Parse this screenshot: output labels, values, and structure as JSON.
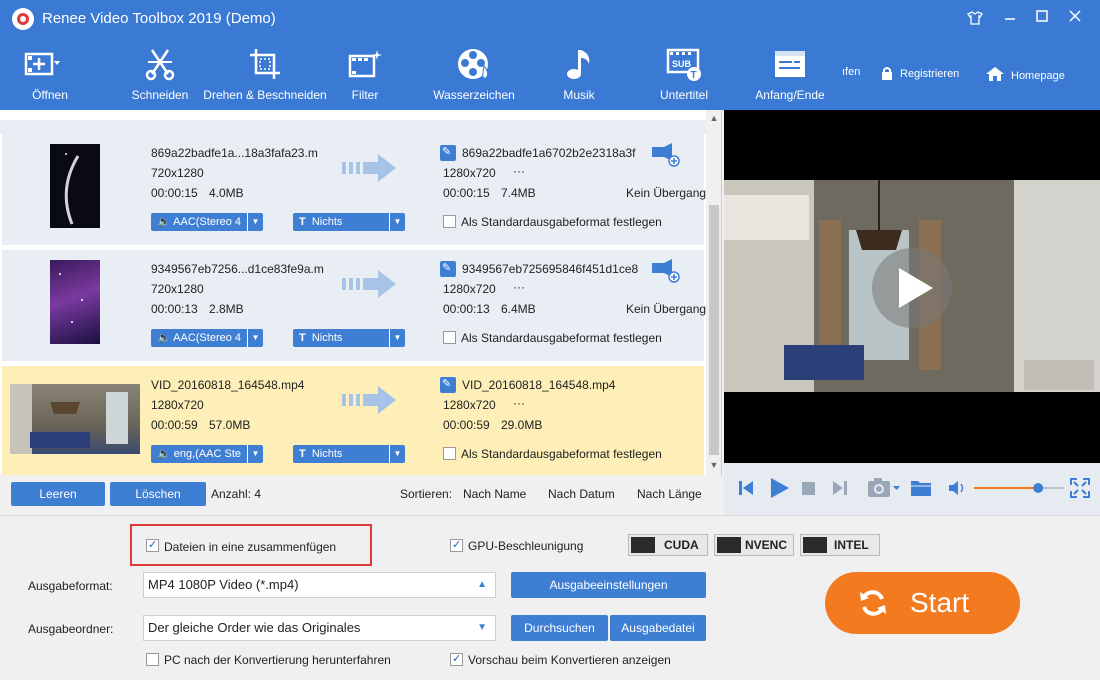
{
  "window": {
    "title": "Renee Video Toolbox 2019 (Demo)"
  },
  "toolbar": {
    "open": "Öffnen",
    "cut": "Schneiden",
    "rotate": "Drehen & Beschneiden",
    "filter": "Filter",
    "watermark": "Wasserzeichen",
    "music": "Musik",
    "subtitle": "Untertitel",
    "start_end": "Anfang/Ende",
    "buy": "ıfen",
    "register": "Registrieren",
    "homepage": "Homepage"
  },
  "files": [
    {
      "src_name": "869a22badfe1a...18a3fafa23.m",
      "src_res": "720x1280",
      "src_dur": "00:00:15",
      "src_size": "4.0MB",
      "out_name": "869a22badfe1a6702b2e2318a3f",
      "out_res": "1280x720",
      "out_extra": "···",
      "out_dur": "00:00:15",
      "out_size": "7.4MB",
      "transition": "Kein Übergang",
      "audio": "AAC(Stereo 4",
      "subtitle": "Nichts",
      "default_label": "Als Standardausgabeformat festlegen"
    },
    {
      "src_name": "9349567eb7256...d1ce83fe9a.m",
      "src_res": "720x1280",
      "src_dur": "00:00:13",
      "src_size": "2.8MB",
      "out_name": "9349567eb725695846f451d1ce8",
      "out_res": "1280x720",
      "out_extra": "···",
      "out_dur": "00:00:13",
      "out_size": "6.4MB",
      "transition": "Kein Übergang",
      "audio": "AAC(Stereo 4",
      "subtitle": "Nichts",
      "default_label": "Als Standardausgabeformat festlegen"
    },
    {
      "src_name": "VID_20160818_164548.mp4",
      "src_res": "1280x720",
      "src_dur": "00:00:59",
      "src_size": "57.0MB",
      "out_name": "VID_20160818_164548.mp4",
      "out_res": "1280x720",
      "out_extra": "···",
      "out_dur": "00:00:59",
      "out_size": "29.0MB",
      "transition": "",
      "audio": "eng,(AAC Ste",
      "subtitle": "Nichts",
      "default_label": "Als Standardausgabeformat festlegen"
    }
  ],
  "listbar": {
    "clear": "Leeren",
    "delete": "Löschen",
    "count": "Anzahl: 4",
    "sort": "Sortieren:",
    "by_name": "Nach Name",
    "by_date": "Nach Datum",
    "by_length": "Nach Länge"
  },
  "player": {
    "volume": 0.74
  },
  "bottom": {
    "merge_label": "Dateien in eine zusammenfügen",
    "merge_checked": true,
    "gpu_label": "GPU-Beschleunigung",
    "gpu_checked": true,
    "badges": [
      "CUDA",
      "NVENC",
      "INTEL"
    ],
    "format_label": "Ausgabeformat:",
    "format_value": "MP4 1080P Video (*.mp4)",
    "settings_btn": "Ausgabeeinstellungen",
    "folder_label": "Ausgabeordner:",
    "folder_value": "Der gleiche Order wie das Originales",
    "browse_btn": "Durchsuchen",
    "output_file_btn": "Ausgabedatei",
    "shutdown_label": "PC nach der Konvertierung herunterfahren",
    "shutdown_checked": false,
    "preview_label": "Vorschau beim Konvertieren anzeigen",
    "preview_checked": true,
    "start": "Start"
  },
  "colors": {
    "brand_blue": "#3a7ad5",
    "button_blue": "#3f7fd3",
    "selected_row": "#fdefb7",
    "start_orange": "#f47a1f",
    "highlight_red": "#e0393a"
  }
}
